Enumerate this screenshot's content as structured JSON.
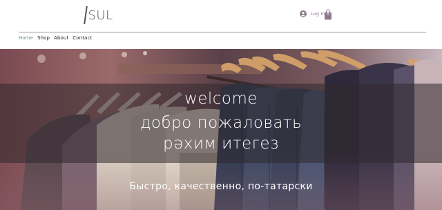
{
  "header": {
    "logo_text": "SUL",
    "login_label": "Log In",
    "cart_count": "0"
  },
  "nav": {
    "items": [
      {
        "label": "Home",
        "active": true
      },
      {
        "label": "Shop",
        "active": false
      },
      {
        "label": "About",
        "active": false
      },
      {
        "label": "Contact",
        "active": false
      }
    ]
  },
  "hero": {
    "line1": "welcome",
    "line2": "добро пожаловать",
    "line3": "рәхим итегез",
    "tagline": "Быстро, качественно, по-татарски"
  },
  "colors": {
    "nav_active": "#6b8a8a",
    "band_overlay": "rgba(50,40,45,0.55)"
  },
  "icons": {
    "login": "user-avatar-icon",
    "cart": "shopping-bag-icon"
  }
}
